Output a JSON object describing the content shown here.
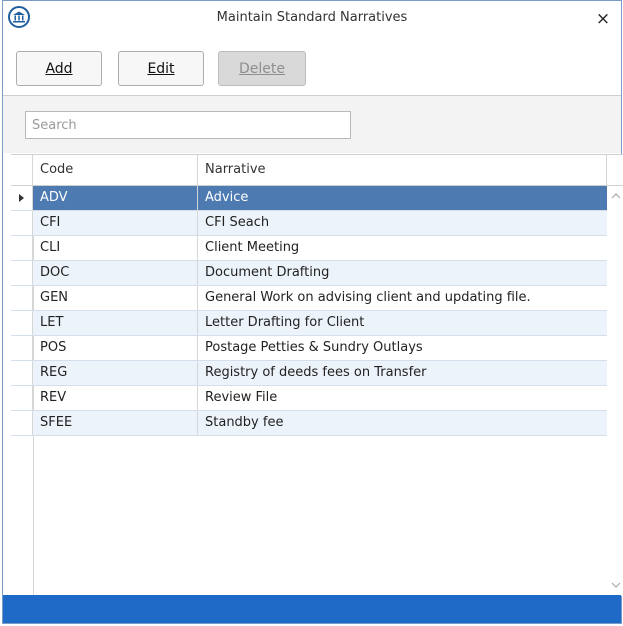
{
  "window": {
    "title": "Maintain Standard Narratives",
    "close_glyph": "×"
  },
  "toolbar": {
    "add_label": "Add",
    "edit_label": "Edit",
    "delete_label": "Delete"
  },
  "search": {
    "placeholder": "Search",
    "value": ""
  },
  "table": {
    "columns": [
      "Code",
      "Narrative"
    ],
    "rows": [
      {
        "code": "ADV",
        "narrative": "Advice"
      },
      {
        "code": "CFI",
        "narrative": "CFI Seach"
      },
      {
        "code": "CLI",
        "narrative": "Client Meeting"
      },
      {
        "code": "DOC",
        "narrative": "Document Drafting"
      },
      {
        "code": "GEN",
        "narrative": "General Work on advising client and updating file."
      },
      {
        "code": "LET",
        "narrative": "Letter Drafting for Client"
      },
      {
        "code": "POS",
        "narrative": "Postage Petties & Sundry Outlays"
      },
      {
        "code": "REG",
        "narrative": "Registry of deeds fees on Transfer"
      },
      {
        "code": "REV",
        "narrative": "Review File"
      },
      {
        "code": "SFEE",
        "narrative": "Standby fee"
      }
    ],
    "selected_row": 0
  },
  "icons": {
    "app": "courthouse-icon",
    "close": "close-icon",
    "row_indicator": "row-pointer-icon",
    "scroll_up": "chevron-up-icon",
    "scroll_down": "chevron-down-icon"
  },
  "colors": {
    "selection": "#4d7bb1",
    "alt_row": "#edf3fa",
    "statusbar": "#1e6ac6"
  }
}
